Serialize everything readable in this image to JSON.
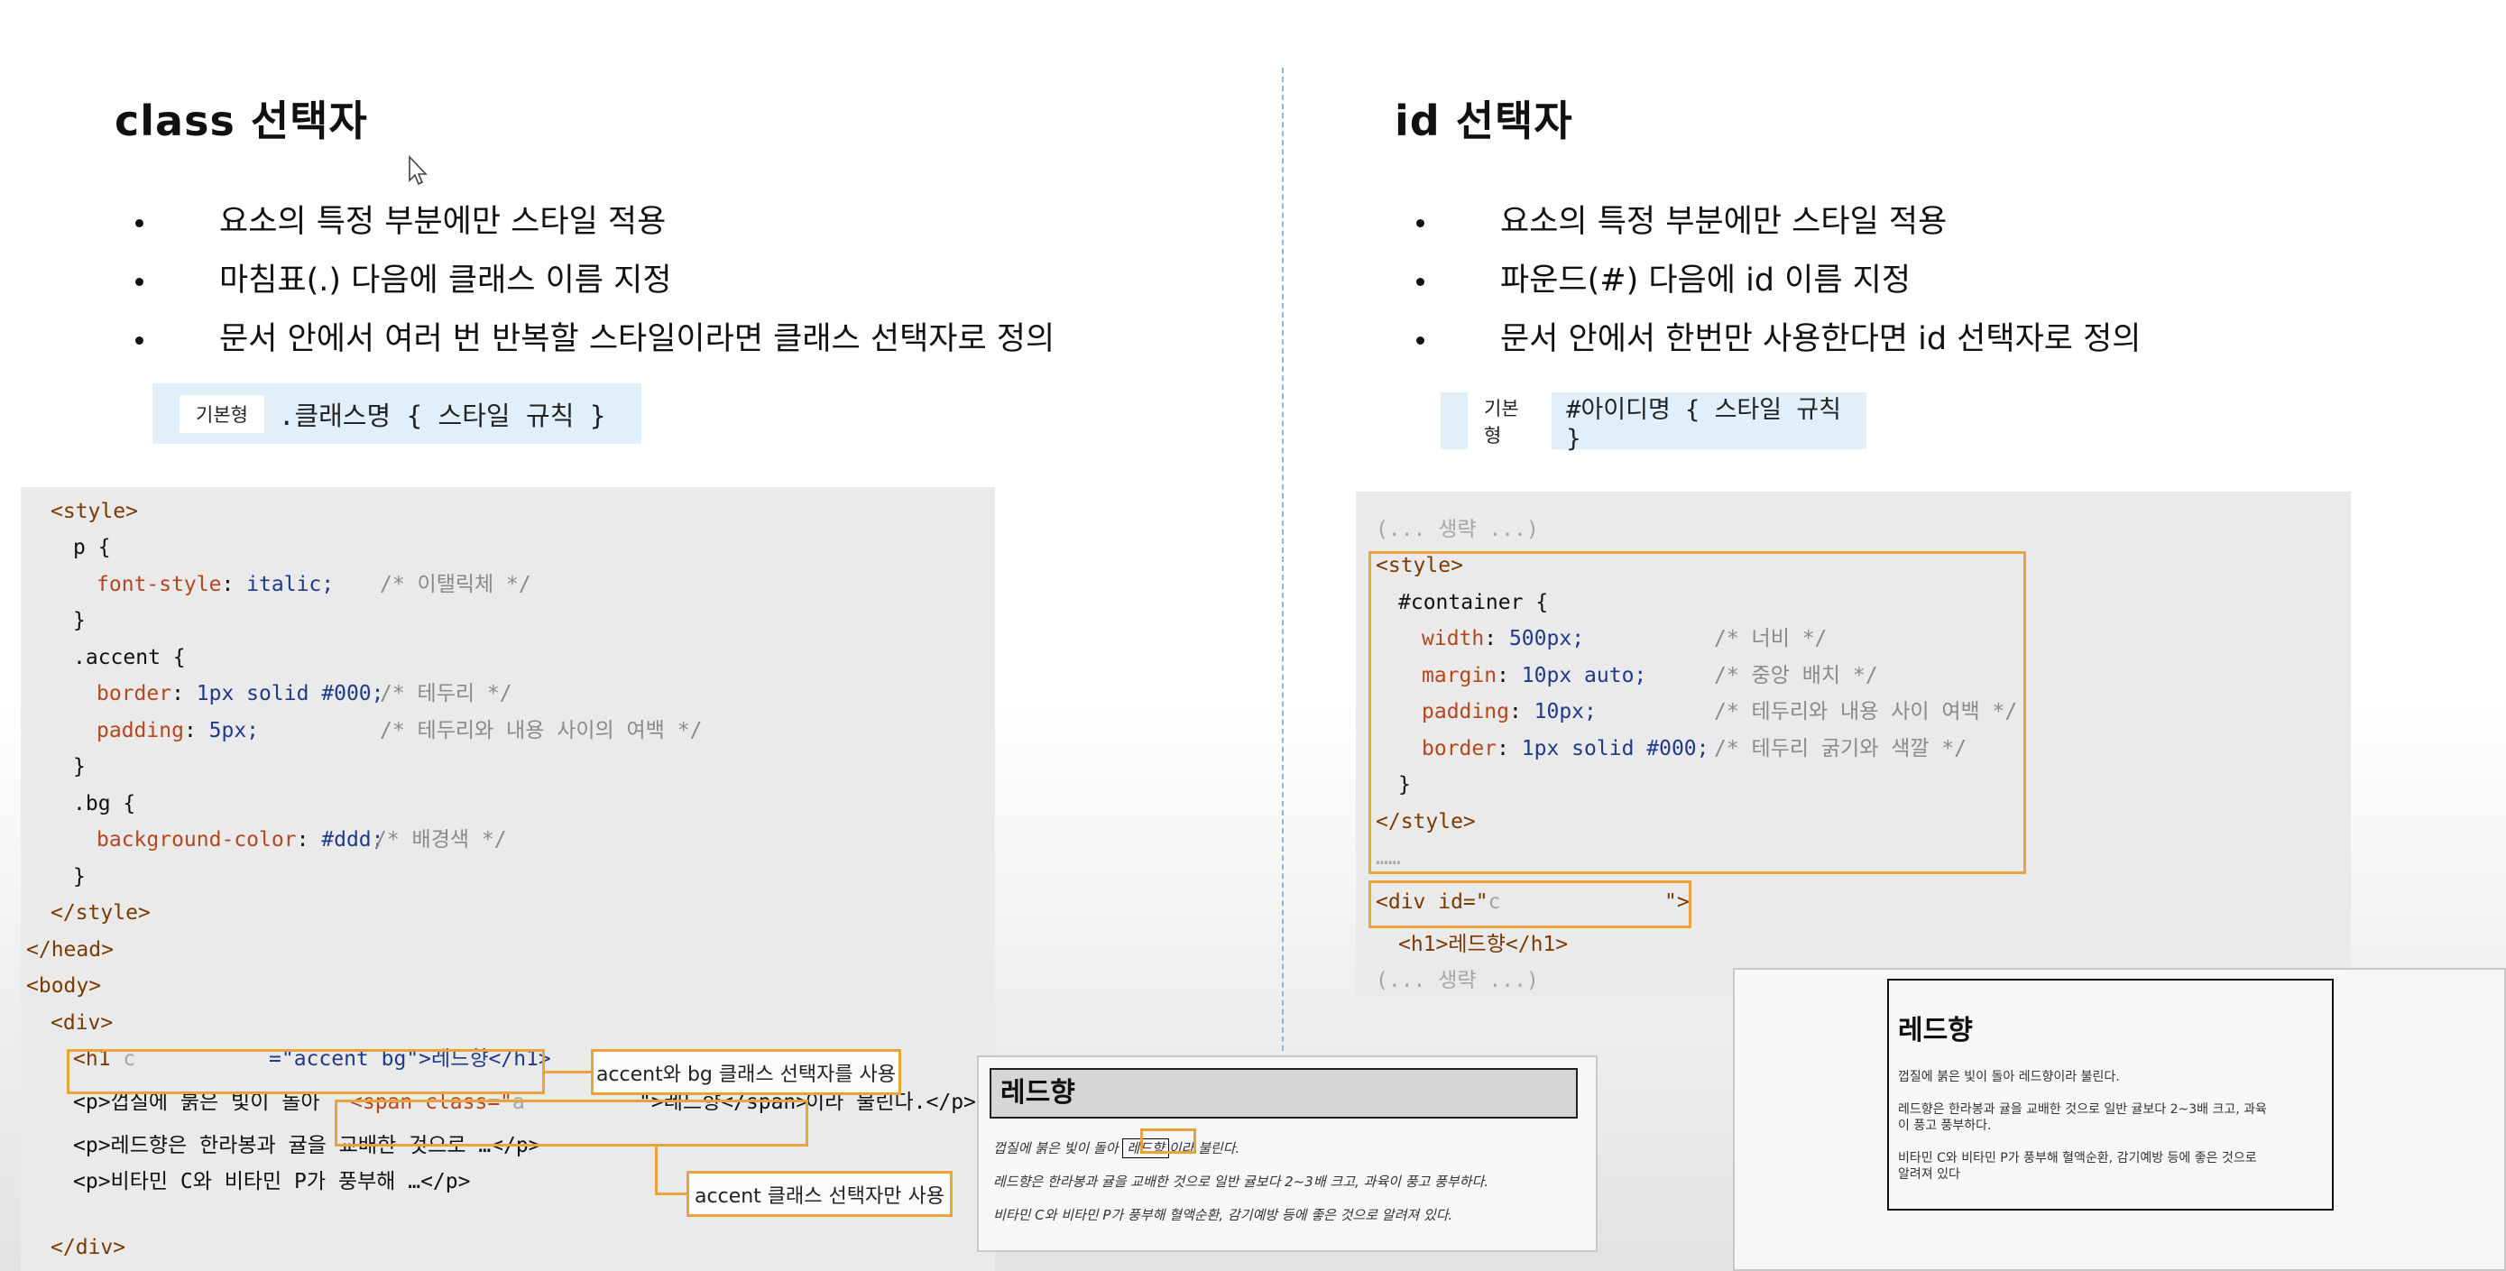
{
  "left": {
    "title": "class 선택자",
    "bullets": [
      "요소의 특정 부분에만 스타일 적용",
      "마침표(.) 다음에 클래스 이름 지정",
      "문서 안에서 여러 번 반복할 스타일이라면 클래스 선택자로 정의"
    ],
    "syntax": {
      "tag": "기본형",
      "rule": ".클래스명 { 스타일 규칙 }"
    },
    "code": {
      "style_open": "<style>",
      "p_sel": "p {",
      "p_prop": "font-style",
      "p_val": "italic;",
      "p_cm": "/* 이탤릭체 */",
      "close1": "}",
      "accent_sel": ".accent {",
      "border_prop": "border",
      "border_val": "1px solid #000;",
      "border_cm": "/* 테두리 */",
      "padding_prop": "padding",
      "padding_val": "5px;",
      "padding_cm": "/* 테두리와 내용 사이의 여백 */",
      "close2": "}",
      "bg_sel": ".bg {",
      "bgc_prop": "background-color",
      "bgc_val": "#ddd;",
      "bgc_cm": "/* 배경색 */",
      "close3": "}",
      "style_close": "</style>",
      "head_close": "</head>",
      "body_open": "<body>",
      "div_open": "<div>",
      "h1_a": "<h1",
      "h1_blank": "c",
      "h1_b": "=\"accent bg\">레드향</h1>",
      "p1_a": "<p>껍질에 붉은 빛이 돌아",
      "p1_span": "<span class=\"",
      "p1_blank": "a",
      "p1_b": "\">레드향</span>",
      "p1_c": "이라 불린다.</p>",
      "p2": "<p>레드향은 한라봉과 귤을 교배한 것으로 …</p>",
      "p3": "<p>비타민 C와 비타민 P가 풍부해 …</p>",
      "div_close": "</div>"
    },
    "callouts": {
      "h1": "accent와 bg 클래스 선택자를 사용",
      "span": "accent 클래스 선택자만 사용"
    },
    "preview": {
      "title": "레드향",
      "line1_a": "껍질에 붉은 빛이 돌아",
      "line1_span": "레드향",
      "line1_b": "이라 불린다.",
      "line2": "레드향은 한라봉과 귤을 교배한 것으로 일반 귤보다 2~3배 크고, 과육이 풍고 풍부하다.",
      "line3": "비타민 C와 비타민 P가 풍부해 혈액순환, 감기예방 등에 좋은 것으로 알려져 있다."
    }
  },
  "right": {
    "title": "id 선택자",
    "bullets": [
      "요소의 특정 부분에만 스타일 적용",
      "파운드(#) 다음에 id 이름 지정",
      "문서 안에서 한번만 사용한다면 id 선택자로 정의"
    ],
    "syntax": {
      "tag": "기본형",
      "rule": "#아이디명 { 스타일 규칙 }"
    },
    "code": {
      "omit1": "(... 생략 ...)",
      "style_open": "<style>",
      "container_sel": "#container {",
      "width_prop": "width",
      "width_val": "500px;",
      "width_cm": "/* 너비 */",
      "margin_prop": "margin",
      "margin_val": "10px auto;",
      "margin_cm": "/* 중앙 배치 */",
      "padding_prop": "padding",
      "padding_val": "10px;",
      "padding_cm": "/* 테두리와 내용 사이 여백 */",
      "border_prop": "border",
      "border_val": "1px solid #000;",
      "border_cm": "/* 테두리 굵기와 색깔 */",
      "close": "}",
      "style_close": "</style>",
      "dots": "……",
      "div_a": "<div id=\"",
      "div_blank": "c",
      "div_b": "\">",
      "h1": "<h1>레드향</h1>",
      "omit2": "(... 생략 ...)"
    },
    "preview": {
      "title": "레드향",
      "line1": "껍질에 붉은 빛이 돌아 레드향이라 불린다.",
      "line2a": "레드향은 한라봉과 귤을 교배한 것으로 일반 귤보다 2~3배 크고, 과육",
      "line2b": "이 풍고 풍부하다.",
      "line3a": "비타민 C와 비타민 P가 풍부해 혈액순환, 감기예방 등에 좋은 것으로",
      "line3b": "알려져 있다"
    }
  }
}
